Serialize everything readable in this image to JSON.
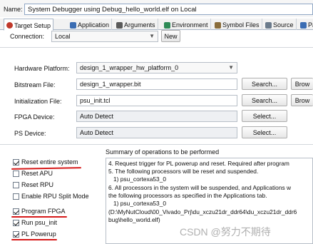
{
  "name_row": {
    "label": "Name:",
    "value": "System Debugger using Debug_hello_world.elf on Local"
  },
  "tabs": [
    {
      "label": "Target Setup",
      "icon": "target-icon",
      "color": "#c0392b"
    },
    {
      "label": "Application",
      "icon": "application-icon",
      "color": "#3b6db3"
    },
    {
      "label": "Arguments",
      "icon": "arguments-icon",
      "color": "#5a5a5a"
    },
    {
      "label": "Environment",
      "icon": "environment-icon",
      "color": "#2e8b57"
    },
    {
      "label": "Symbol Files",
      "icon": "symbol-files-icon",
      "color": "#8a6d3b"
    },
    {
      "label": "Source",
      "icon": "source-icon",
      "color": "#6b7b8c"
    },
    {
      "label": "Pa",
      "icon": "path-icon",
      "color": "#3b6db3"
    }
  ],
  "connection": {
    "label": "Connection:",
    "value": "Local",
    "new_label": "New"
  },
  "hardware_platform": {
    "label": "Hardware Platform:",
    "value": "design_1_wrapper_hw_platform_0"
  },
  "bitstream": {
    "label": "Bitstream File:",
    "value": "design_1_wrapper.bit",
    "search_label": "Search...",
    "browse_label": "Brow"
  },
  "init_file": {
    "label": "Initialization File:",
    "value": "psu_init.tcl",
    "search_label": "Search...",
    "browse_label": "Brow"
  },
  "fpga_device": {
    "label": "FPGA Device:",
    "value": "Auto Detect",
    "select_label": "Select..."
  },
  "ps_device": {
    "label": "PS Device:",
    "value": "Auto Detect",
    "select_label": "Select..."
  },
  "options": [
    {
      "label": "Reset entire system",
      "checked": true,
      "highlighted": true
    },
    {
      "label": "Reset APU",
      "checked": false,
      "highlighted": false
    },
    {
      "label": "Reset RPU",
      "checked": false,
      "highlighted": false
    },
    {
      "label": "Enable RPU Split Mode",
      "checked": false,
      "highlighted": false
    },
    {
      "label": "Program FPGA",
      "checked": true,
      "highlighted": true
    },
    {
      "label": "Run psu_init",
      "checked": true,
      "highlighted": false
    },
    {
      "label": "PL Powerup",
      "checked": true,
      "highlighted": true
    }
  ],
  "summary": {
    "title": "Summary of operations to be performed",
    "lines": [
      "4. Request trigger for PL powerup and reset. Required after program",
      "5. The following processors will be reset and suspended.",
      "    1) psu_cortexa53_0",
      "6. All processors in the system will be suspended, and Applications w",
      "the following processors as specified in the Applications tab.",
      "    1) psu_cortexa53_0",
      "(D:\\MyNutCloud\\00_Vivado_Prj\\du_xczu21dr_ddr64\\du_xczu21dr_ddr6",
      "bug\\hello_world.elf)"
    ]
  },
  "watermark": "CSDN @努力不期待",
  "colors": {
    "highlight_underline": "#d61a1a",
    "field_border": "#b7bec7"
  }
}
